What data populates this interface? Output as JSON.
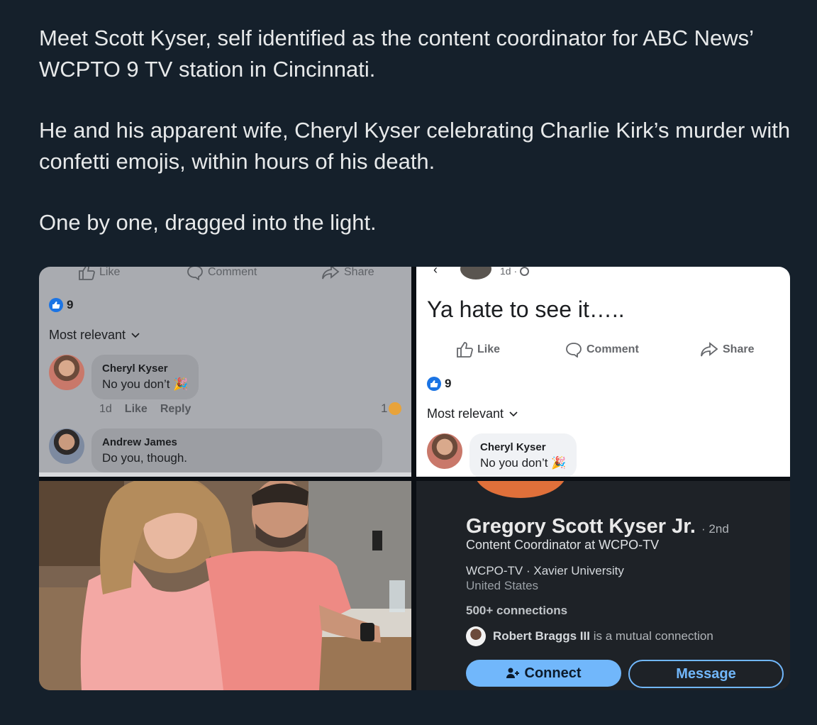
{
  "tweet": {
    "paragraphs": [
      "Meet Scott Kyser, self identified as the content coordinator for ABC News’ WCPTO 9 TV station in Cincinnati.",
      "He and his apparent wife, Cheryl Kyser celebrating Charlie Kirk’s murder with confetti emojis, within hours of his death.",
      "One by one, dragged into the light."
    ]
  },
  "fb_left": {
    "actions": {
      "like": "Like",
      "comment": "Comment",
      "share": "Share"
    },
    "like_count": "9",
    "sort_label": "Most relevant",
    "comments": [
      {
        "name": "Cheryl Kyser",
        "text": "No you don’t",
        "emoji": "🎉",
        "time": "1d",
        "like": "Like",
        "reply": "Reply",
        "reaction_count": "1"
      },
      {
        "name": "Andrew James",
        "text": "Do you, though."
      }
    ]
  },
  "fb_right": {
    "time": "1d ·",
    "post_text": "Ya hate to see it…..",
    "actions": {
      "like": "Like",
      "comment": "Comment",
      "share": "Share"
    },
    "like_count": "9",
    "sort_label": "Most relevant",
    "comment": {
      "name": "Cheryl Kyser",
      "text": "No you don’t",
      "emoji": "🎉"
    }
  },
  "linkedin": {
    "name": "Gregory Scott Kyser Jr.",
    "degree": "· 2nd",
    "headline": "Content Coordinator at WCPO-TV",
    "orgs": "WCPO-TV · Xavier University",
    "location": "United States",
    "connections": "500+ connections",
    "mutual_name": "Robert Braggs III",
    "mutual_suffix": " is a mutual connection",
    "connect_label": "Connect",
    "message_label": "Message",
    "more_label": "···"
  },
  "colors": {
    "background": "#15202b",
    "fb_left_bg": "#a9abb0",
    "linkedin_bg": "#1e2227",
    "linkedin_accent": "#71b7fb",
    "fb_like_blue": "#1b74e4"
  }
}
